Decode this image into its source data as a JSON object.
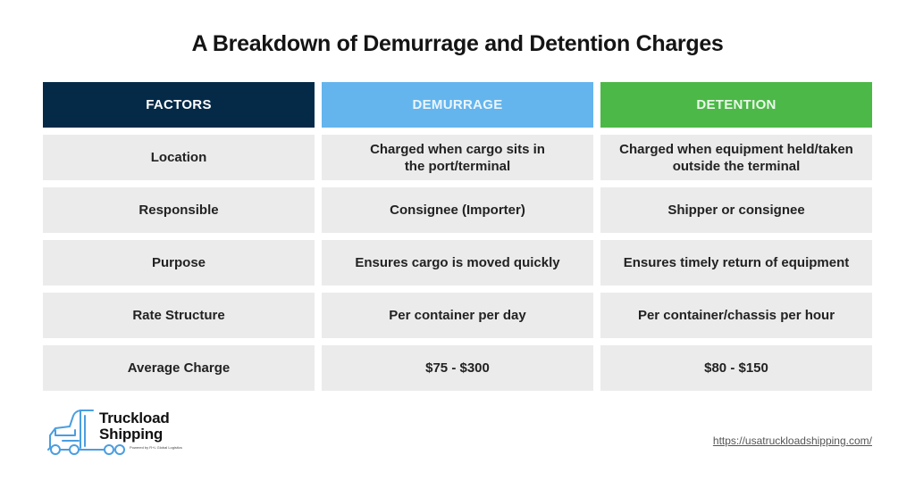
{
  "title": "A Breakdown of Demurrage and Detention Charges",
  "table": {
    "headers": [
      {
        "label": "FACTORS",
        "color": "#042a48"
      },
      {
        "label": "DEMURRAGE",
        "color": "#64b5ed"
      },
      {
        "label": "DETENTION",
        "color": "#4cb847"
      }
    ],
    "rows": [
      {
        "factor": "Location",
        "demurrage": "Charged when cargo sits in the port/terminal",
        "detention": "Charged when equipment held/taken outside the terminal"
      },
      {
        "factor": "Responsible",
        "demurrage": "Consignee (Importer)",
        "detention": "Shipper or consignee"
      },
      {
        "factor": "Purpose",
        "demurrage": "Ensures cargo is moved quickly",
        "detention": "Ensures timely return of equipment"
      },
      {
        "factor": "Rate Structure",
        "demurrage": "Per container per day",
        "detention": "Per container/chassis per hour"
      },
      {
        "factor": "Average Charge",
        "demurrage": "$75 - $300",
        "detention": "$80 - $150"
      }
    ]
  },
  "logo": {
    "icon": "truck-icon",
    "line1": "Truckload",
    "line2": "Shipping",
    "tagline": "Powered by R+L Global Logistics"
  },
  "footer": {
    "url": "https://usatruckloadshipping.com/"
  }
}
